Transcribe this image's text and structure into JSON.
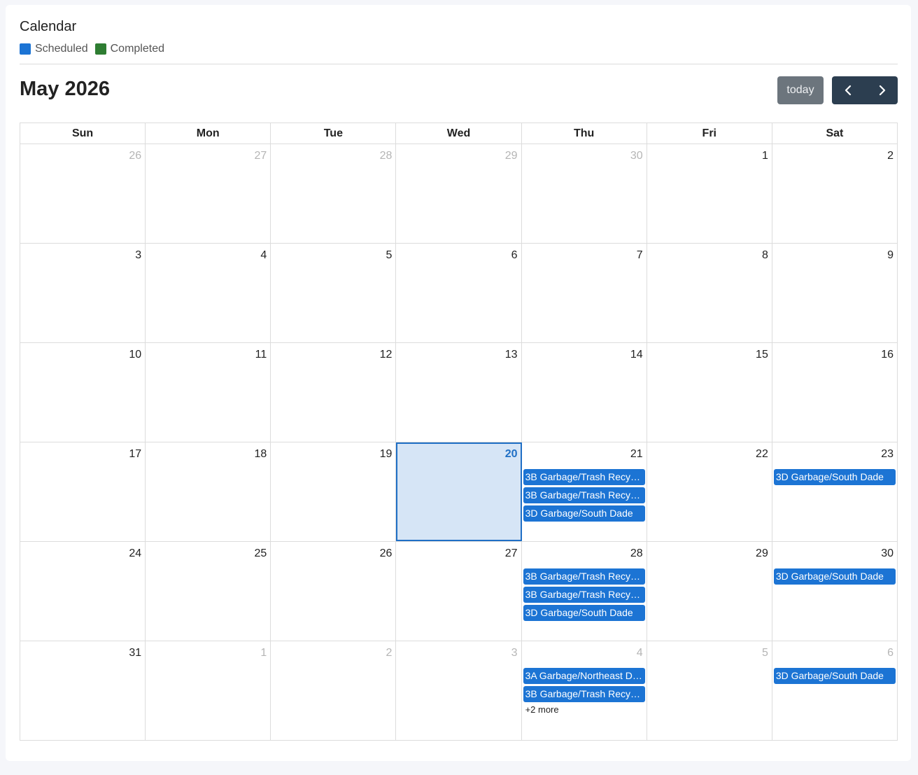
{
  "header": {
    "title": "Calendar",
    "legend": [
      {
        "label": "Scheduled",
        "color": "#1c74d4"
      },
      {
        "label": "Completed",
        "color": "#2e7d32"
      }
    ]
  },
  "toolbar": {
    "month_title": "May 2026",
    "today_label": "today",
    "prev_icon": "chevron-left-icon",
    "next_icon": "chevron-right-icon"
  },
  "weekdays": [
    "Sun",
    "Mon",
    "Tue",
    "Wed",
    "Thu",
    "Fri",
    "Sat"
  ],
  "weeks": [
    [
      {
        "day": "26",
        "other": true
      },
      {
        "day": "27",
        "other": true
      },
      {
        "day": "28",
        "other": true
      },
      {
        "day": "29",
        "other": true
      },
      {
        "day": "30",
        "other": true
      },
      {
        "day": "1"
      },
      {
        "day": "2"
      }
    ],
    [
      {
        "day": "3"
      },
      {
        "day": "4"
      },
      {
        "day": "5"
      },
      {
        "day": "6"
      },
      {
        "day": "7"
      },
      {
        "day": "8"
      },
      {
        "day": "9"
      }
    ],
    [
      {
        "day": "10"
      },
      {
        "day": "11"
      },
      {
        "day": "12"
      },
      {
        "day": "13"
      },
      {
        "day": "14"
      },
      {
        "day": "15"
      },
      {
        "day": "16"
      }
    ],
    [
      {
        "day": "17"
      },
      {
        "day": "18"
      },
      {
        "day": "19"
      },
      {
        "day": "20",
        "today": true
      },
      {
        "day": "21",
        "events": [
          "3B Garbage/Trash Recycling",
          "3B Garbage/Trash Recycling",
          "3D Garbage/South Dade"
        ]
      },
      {
        "day": "22"
      },
      {
        "day": "23",
        "events": [
          "3D Garbage/South Dade"
        ]
      }
    ],
    [
      {
        "day": "24"
      },
      {
        "day": "25"
      },
      {
        "day": "26"
      },
      {
        "day": "27"
      },
      {
        "day": "28",
        "events": [
          "3B Garbage/Trash Recycling",
          "3B Garbage/Trash Recycling",
          "3D Garbage/South Dade"
        ]
      },
      {
        "day": "29"
      },
      {
        "day": "30",
        "events": [
          "3D Garbage/South Dade"
        ]
      }
    ],
    [
      {
        "day": "31"
      },
      {
        "day": "1",
        "other": true
      },
      {
        "day": "2",
        "other": true
      },
      {
        "day": "3",
        "other": true
      },
      {
        "day": "4",
        "other": true,
        "events": [
          "3A Garbage/Northeast Dade",
          "3B Garbage/Trash Recycling"
        ],
        "more": "+2 more"
      },
      {
        "day": "5",
        "other": true
      },
      {
        "day": "6",
        "other": true,
        "events": [
          "3D Garbage/South Dade"
        ]
      }
    ]
  ]
}
